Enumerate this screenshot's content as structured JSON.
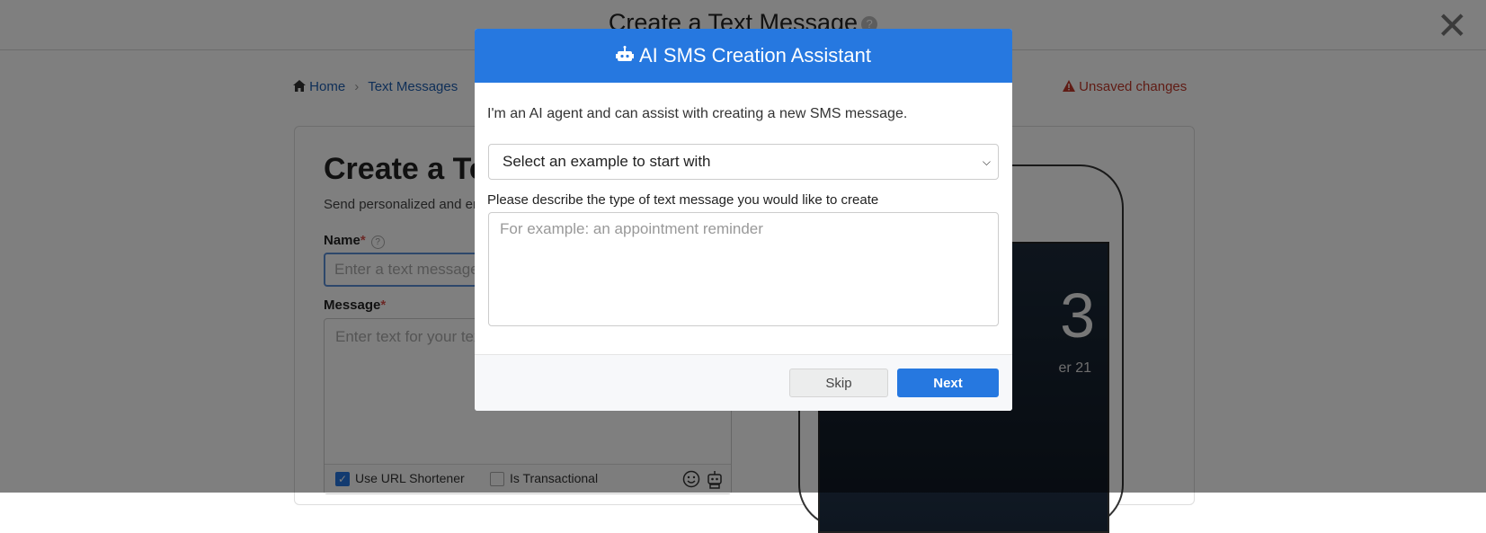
{
  "page": {
    "title": "Create a Text Message",
    "help_glyph": "?",
    "close_glyph": "✕"
  },
  "breadcrumb": {
    "home": "Home",
    "text_messages": "Text Messages",
    "separator": "›"
  },
  "unsaved": "Unsaved changes",
  "form": {
    "heading": "Create a Text Message",
    "subheading": "Send personalized and engaging text messages",
    "name_label": "Name",
    "name_placeholder": "Enter a text message name",
    "message_label": "Message",
    "message_placeholder": "Enter text for your text message",
    "required_mark": "*",
    "url_shortener": "Use URL Shortener",
    "is_transactional": "Is Transactional"
  },
  "phone": {
    "clock": "3",
    "date": "er 21"
  },
  "modal": {
    "title": "AI SMS Creation Assistant",
    "intro": "I'm an AI agent and can assist with creating a new SMS message.",
    "select_value": "Select an example to start with",
    "description_label": "Please describe the type of text message you would like to create",
    "description_placeholder": "For example: an appointment reminder",
    "skip_label": "Skip",
    "next_label": "Next"
  },
  "colors": {
    "primary": "#2678e0",
    "danger": "#c0392b"
  }
}
